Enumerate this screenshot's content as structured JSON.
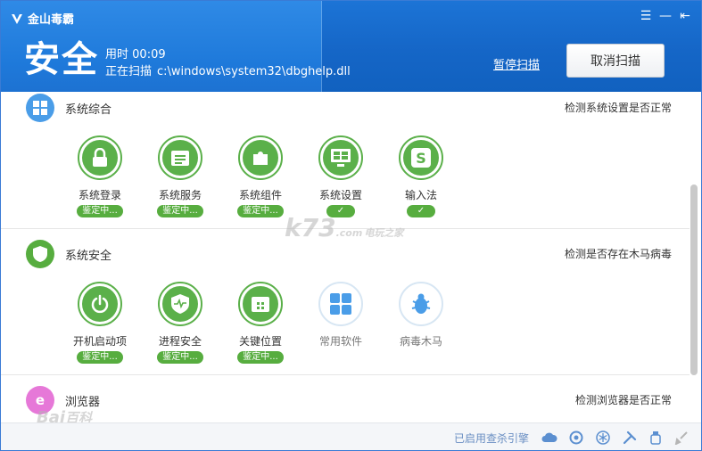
{
  "app": {
    "logo_text": "金山毒霸"
  },
  "header": {
    "status": "安全",
    "time_label": "用时",
    "time_value": "00:09",
    "scanning_label": "正在扫描",
    "scanning_path": "c:\\windows\\system32\\dbghelp.dll",
    "pause_label": "暂停扫描",
    "cancel_label": "取消扫描"
  },
  "window_controls": {
    "menu": "☰",
    "minimize": "—",
    "restore": "⇤"
  },
  "sections": [
    {
      "title": "系统综合",
      "description": "检测系统设置是否正常",
      "items": [
        {
          "label": "系统登录",
          "status": "鉴定中..."
        },
        {
          "label": "系统服务",
          "status": "鉴定中..."
        },
        {
          "label": "系统组件",
          "status": "鉴定中..."
        },
        {
          "label": "系统设置",
          "status": "✓"
        },
        {
          "label": "输入法",
          "status": "✓"
        }
      ]
    },
    {
      "title": "系统安全",
      "description": "检测是否存在木马病毒",
      "items": [
        {
          "label": "开机启动项",
          "status": "鉴定中..."
        },
        {
          "label": "进程安全",
          "status": "鉴定中..."
        },
        {
          "label": "关键位置",
          "status": "鉴定中..."
        },
        {
          "label": "常用软件",
          "status": ""
        },
        {
          "label": "病毒木马",
          "status": ""
        }
      ]
    },
    {
      "title": "浏览器",
      "description": "检测浏览器是否正常",
      "items": []
    }
  ],
  "footer": {
    "link": "已启用查杀引擎"
  },
  "watermarks": {
    "k73": "k73",
    "k73_sub": "电玩之家",
    "k73_domain": ".com",
    "baidu": "Bai",
    "baidu_tail": "百科"
  },
  "colors": {
    "header_blue": "#1566c7",
    "accent_green": "#57ad3f",
    "section_blue": "#4a9de8",
    "browser_pink": "#e678d8"
  }
}
